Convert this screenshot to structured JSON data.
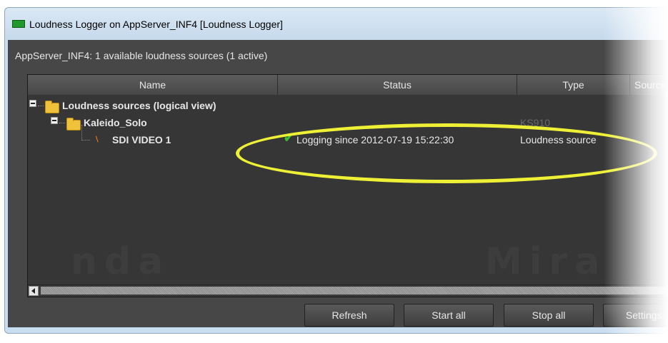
{
  "window": {
    "title": "Loudness Logger on AppServer_INF4 [Loudness Logger]"
  },
  "summary": "AppServer_INF4: 1 available loudness sources (1 active)",
  "table": {
    "columns": [
      "Name",
      "Status",
      "Type",
      "Source"
    ],
    "rows": [
      {
        "name": "Loudness sources (logical view)",
        "status": "",
        "type": ""
      },
      {
        "name": "Kaleido_Solo",
        "status": "",
        "type": "KS910"
      },
      {
        "name": "SDI VIDEO 1",
        "status": "Logging since 2012-07-19 15:22:30",
        "type": "Loudness source"
      }
    ]
  },
  "watermark": [
    "nda",
    "Mira"
  ],
  "buttons": {
    "refresh": "Refresh",
    "start_all": "Start all",
    "stop_all": "Stop all",
    "settings": "Settings..."
  },
  "icons": {
    "title": "green-monitor-icon",
    "tree": [
      "collapse-icon",
      "folder-icon",
      "rss-source-icon",
      "checkmark-icon"
    ]
  },
  "colors": {
    "highlight_ellipse": "#eef036",
    "status_ok": "#36c22f",
    "panel_bg": "#474747"
  }
}
